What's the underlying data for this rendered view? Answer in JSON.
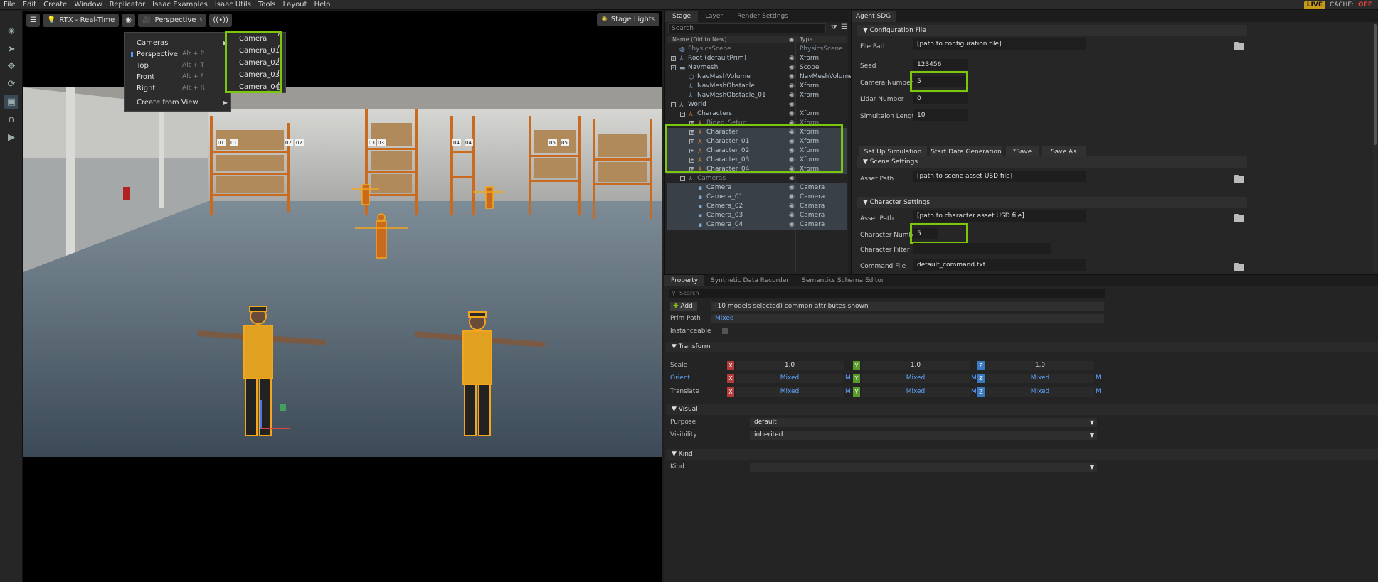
{
  "menubar": {
    "items": [
      "File",
      "Edit",
      "Create",
      "Window",
      "Replicator",
      "Isaac Examples",
      "Isaac Utils",
      "Tools",
      "Layout",
      "Help"
    ],
    "live": "LIVE",
    "cache_label": "CACHE:",
    "cache_state": "OFF"
  },
  "viewport": {
    "renderer": "RTX - Real-Time",
    "camera": "Perspective",
    "stage_lights": "Stage Lights"
  },
  "camera_menu": {
    "items": [
      {
        "label": "Cameras",
        "shortcut": "",
        "submenu": true
      },
      {
        "label": "Perspective",
        "shortcut": "Alt + P",
        "active": true
      },
      {
        "label": "Top",
        "shortcut": "Alt + T"
      },
      {
        "label": "Front",
        "shortcut": "Alt + F"
      },
      {
        "label": "Right",
        "shortcut": "Alt + R"
      },
      {
        "label": "Create from View",
        "shortcut": "",
        "submenu": true
      }
    ],
    "cameras": [
      "Camera",
      "Camera_01",
      "Camera_02",
      "Camera_03",
      "Camera_04"
    ]
  },
  "stage": {
    "tabs": [
      "Stage",
      "Layer",
      "Render Settings"
    ],
    "search_placeholder": "Search",
    "col_name": "Name (Old to New)",
    "col_type": "Type",
    "rows": [
      {
        "name": "PhysicsScene",
        "type": "PhysicsScene",
        "indent": 0,
        "dim": true
      },
      {
        "name": "Root (defaultPrim)",
        "type": "Xform",
        "indent": 0,
        "exp": "+"
      },
      {
        "name": "Navmesh",
        "type": "Scope",
        "indent": 0,
        "exp": "-"
      },
      {
        "name": "NavMeshVolume",
        "type": "NavMeshVolume",
        "indent": 1
      },
      {
        "name": "NavMeshObstacle",
        "type": "Xform",
        "indent": 1
      },
      {
        "name": "NavMeshObstacle_01",
        "type": "Xform",
        "indent": 1
      },
      {
        "name": "World",
        "type": "",
        "indent": 0,
        "exp": "-"
      },
      {
        "name": "Characters",
        "type": "Xform",
        "indent": 1,
        "exp": "-"
      },
      {
        "name": "Biped_Setup",
        "type": "Xform",
        "indent": 2,
        "exp": "+",
        "dim": true
      },
      {
        "name": "Character",
        "type": "Xform",
        "indent": 2,
        "exp": "+",
        "selected": true
      },
      {
        "name": "Character_01",
        "type": "Xform",
        "indent": 2,
        "exp": "+",
        "selected": true
      },
      {
        "name": "Character_02",
        "type": "Xform",
        "indent": 2,
        "exp": "+",
        "selected": true
      },
      {
        "name": "Character_03",
        "type": "Xform",
        "indent": 2,
        "exp": "+",
        "selected": true
      },
      {
        "name": "Character_04",
        "type": "Xform",
        "indent": 2,
        "exp": "+",
        "selected": true
      },
      {
        "name": "Cameras",
        "type": "",
        "indent": 1,
        "exp": "-",
        "dim": true
      },
      {
        "name": "Camera",
        "type": "Camera",
        "indent": 2,
        "selected": true
      },
      {
        "name": "Camera_01",
        "type": "Camera",
        "indent": 2,
        "selected": true
      },
      {
        "name": "Camera_02",
        "type": "Camera",
        "indent": 2,
        "selected": true
      },
      {
        "name": "Camera_03",
        "type": "Camera",
        "indent": 2,
        "selected": true
      },
      {
        "name": "Camera_04",
        "type": "Camera",
        "indent": 2,
        "selected": true
      }
    ]
  },
  "sdg": {
    "tab": "Agent SDG",
    "config_section": "Configuration File",
    "file_path_label": "File Path",
    "file_path_value": "[path to configuration file]",
    "seed_label": "Seed",
    "seed_value": "123456",
    "camera_number_label": "Camera Number",
    "camera_number_value": "5",
    "lidar_number_label": "Lidar Number",
    "lidar_number_value": "0",
    "sim_length_label": "Simultaion Length",
    "sim_length_value": "10",
    "buttons": [
      "Set Up Simulation",
      "Start Data Generation",
      "*Save",
      "Save As"
    ],
    "scene_section": "Scene Settings",
    "scene_asset_label": "Asset Path",
    "scene_asset_value": "[path to scene asset USD file]",
    "char_section": "Character Settings",
    "char_asset_label": "Asset Path",
    "char_asset_value": "[path to character asset USD file]",
    "char_number_label": "Character Number",
    "char_number_value": "5",
    "char_filter_label": "Character Filter",
    "char_filter_value": "",
    "command_file_label": "Command File",
    "command_file_value": "default_command.txt"
  },
  "property": {
    "tabs": [
      "Property",
      "Synthetic Data Recorder",
      "Semantics Schema Editor"
    ],
    "search_placeholder": "Search",
    "add_label": "Add",
    "summary": "(10 models selected) common attributes shown",
    "prim_path_label": "Prim Path",
    "prim_path_value": "Mixed",
    "instanceable_label": "Instanceable",
    "transform_section": "Transform",
    "scale_label": "Scale",
    "orient_label": "Orient",
    "translate_label": "Translate",
    "scale": [
      "1.0",
      "1.0",
      "1.0"
    ],
    "orient": [
      "Mixed",
      "Mixed",
      "Mixed"
    ],
    "translate": [
      "Mixed",
      "Mixed",
      "Mixed"
    ],
    "axis": [
      "X",
      "Y",
      "Z"
    ],
    "mixed_marker": "M",
    "visual_section": "Visual",
    "purpose_label": "Purpose",
    "purpose_value": "default",
    "visibility_label": "Visibility",
    "visibility_value": "inherited",
    "kind_section": "Kind",
    "kind_label": "Kind",
    "kind_value": ""
  },
  "rack_labels": [
    "01",
    "01",
    "02",
    "02",
    "03",
    "03",
    "04",
    "04",
    "05",
    "05"
  ],
  "colors": {
    "highlight": "#7ac70c",
    "selection_outline": "#f2a51d",
    "accent_blue": "#4fa3ff"
  }
}
